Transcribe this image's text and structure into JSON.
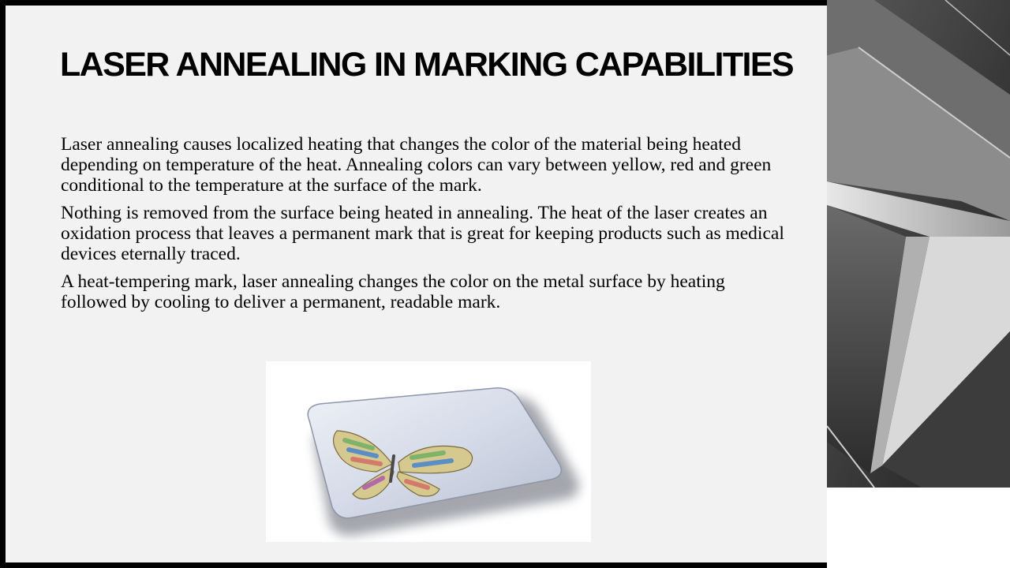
{
  "slide": {
    "title": "LASER ANNEALING IN MARKING CAPABILITIES",
    "paragraphs": [
      "Laser annealing causes localized heating that changes the color of the material being heated depending on temperature of the heat. Annealing colors can vary between yellow, red and green conditional to the temperature at the surface of the mark.",
      "Nothing is removed from the surface being heated in annealing. The heat of the laser creates an oxidation process that leaves a permanent mark that is great for keeping products such as medical devices eternally traced.",
      "A heat-tempering mark, laser annealing changes the color on the metal surface by heating followed by cooling to deliver a permanent, readable mark."
    ]
  },
  "images": {
    "product_photo_icon": "butterfly-marked-metal-plate",
    "side_photo_icon": "abstract-concrete-star"
  },
  "colors": {
    "frame": "#000000",
    "panel": "#f2f2f2",
    "text": "#000000"
  }
}
